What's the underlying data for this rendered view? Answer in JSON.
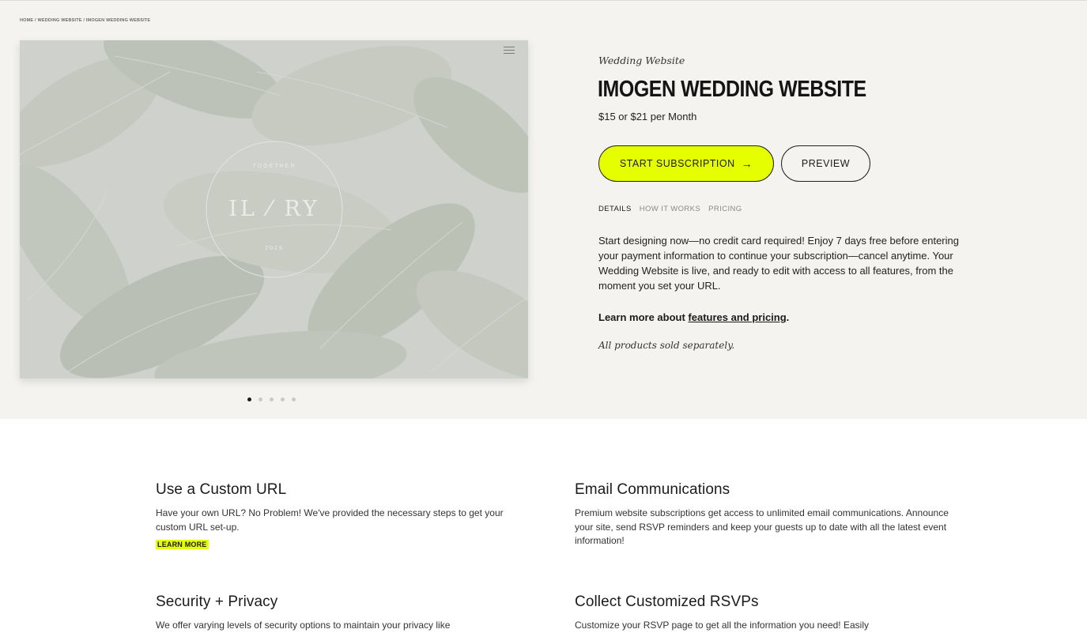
{
  "breadcrumb": "HOME / WEDDING WEBSITE / IMOGEN WEDDING WEBSITE",
  "product": {
    "eyebrow": "Wedding Website",
    "title": "IMOGEN WEDDING WEBSITE",
    "price": "$15 or $21 per Month",
    "primary_button": "START SUBSCRIPTION",
    "secondary_button": "PREVIEW",
    "tabs": [
      "DETAILS",
      "HOW IT WORKS",
      "PRICING"
    ],
    "description": "Start designing now—no credit card required! Enjoy 7 days free before entering your payment information to continue your subscription—cancel anytime. Your Wedding Website is live, and ready to edit with access to all features, from the moment you set your URL.",
    "learn_more_prefix": "Learn more about ",
    "learn_more_link": "features and pricing",
    "learn_more_suffix": ".",
    "sold_separately": "All products sold separately."
  },
  "gallery": {
    "monogram": "IL ⁄ RY",
    "seal_top": "TOGETHER",
    "seal_bottom": "2025",
    "slide_count": 5,
    "active_slide": 1
  },
  "features": [
    {
      "title": "Use a Custom URL",
      "body": "Have your own URL? No Problem! We've provided the necessary steps to get your custom URL set-up.",
      "link": "LEARN MORE"
    },
    {
      "title": "Email Communications",
      "body": "Premium website subscriptions get access to unlimited email communications. Announce your site, send RSVP reminders and keep your guests up to date with all the latest event information!"
    },
    {
      "title": "Security + Privacy",
      "body": "We offer varying levels of security options to maintain your privacy like"
    },
    {
      "title": "Collect Customized RSVPs",
      "body": "Customize your RSVP page to get all the information you need! Easily"
    }
  ],
  "colors": {
    "accent": "#e5ff00",
    "hero_bg": "#f4f3ef",
    "text": "#1b1b1b"
  },
  "icons": [
    "hamburger-menu-icon",
    "arrow-right-icon"
  ]
}
